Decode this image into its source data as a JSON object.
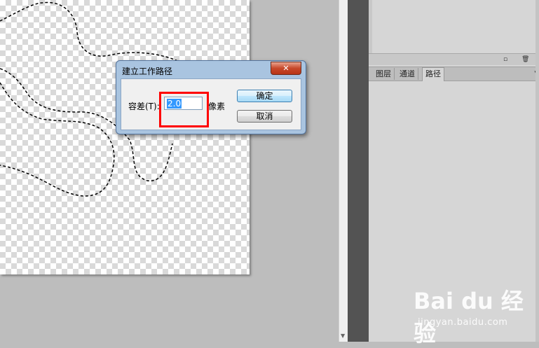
{
  "dialog": {
    "title": "建立工作路径",
    "close_symbol": "✕",
    "tolerance_label": "容差(T):",
    "tolerance_value": "2.0",
    "unit_label": "像素",
    "ok_label": "确定",
    "cancel_label": "取消"
  },
  "panel": {
    "tabs": [
      {
        "label": "图层"
      },
      {
        "label": "通道"
      },
      {
        "label": "路径"
      }
    ],
    "active_tab": "路径",
    "menu_icon": "menu-arrow-icon",
    "footer_icons": [
      "new-icon",
      "trash-icon"
    ]
  },
  "watermark": {
    "logo_text": "Bai du 经验",
    "url": "jingyan.baidu.com"
  },
  "colors": {
    "highlight": "#ff0000",
    "selection_highlight": "#3399ff",
    "dialog_frame": "#a9c4e0"
  }
}
